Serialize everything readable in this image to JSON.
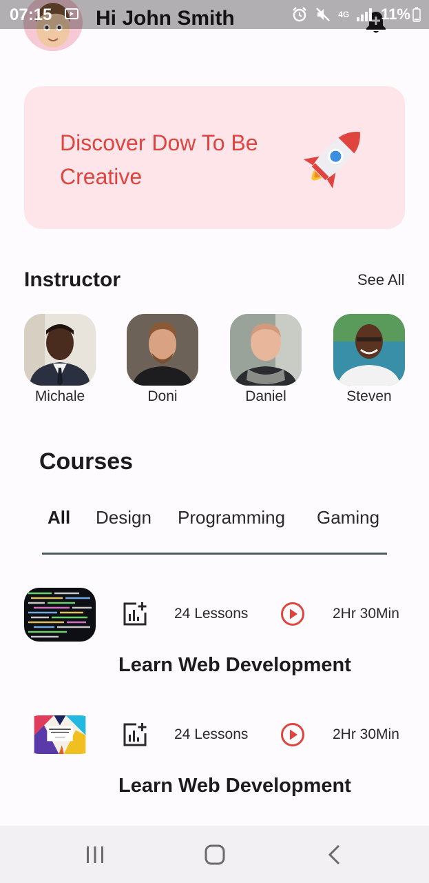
{
  "status_bar": {
    "time": "07:15",
    "network": "4G",
    "battery": "11%"
  },
  "header": {
    "greeting": "Hi John Smith"
  },
  "banner": {
    "text": "Discover Dow To Be Creative"
  },
  "instructors": {
    "title": "Instructor",
    "see_all": "See All",
    "items": [
      {
        "name": "Michale"
      },
      {
        "name": "Doni"
      },
      {
        "name": "Daniel"
      },
      {
        "name": "Steven"
      }
    ]
  },
  "courses": {
    "title": "Courses",
    "tabs": [
      {
        "label": "All",
        "active": true
      },
      {
        "label": "Design",
        "active": false
      },
      {
        "label": "Programming",
        "active": false
      },
      {
        "label": "Gaming",
        "active": false
      }
    ],
    "items": [
      {
        "lessons": "24 Lessons",
        "duration": "2Hr 30Min",
        "title": "Learn Web Development"
      },
      {
        "lessons": "24 Lessons",
        "duration": "2Hr 30Min",
        "title": "Learn Web Development"
      }
    ]
  },
  "colors": {
    "accent": "#e0443e",
    "banner_bg": "#fde5ea",
    "tab_indicator": "#4a5a63"
  }
}
